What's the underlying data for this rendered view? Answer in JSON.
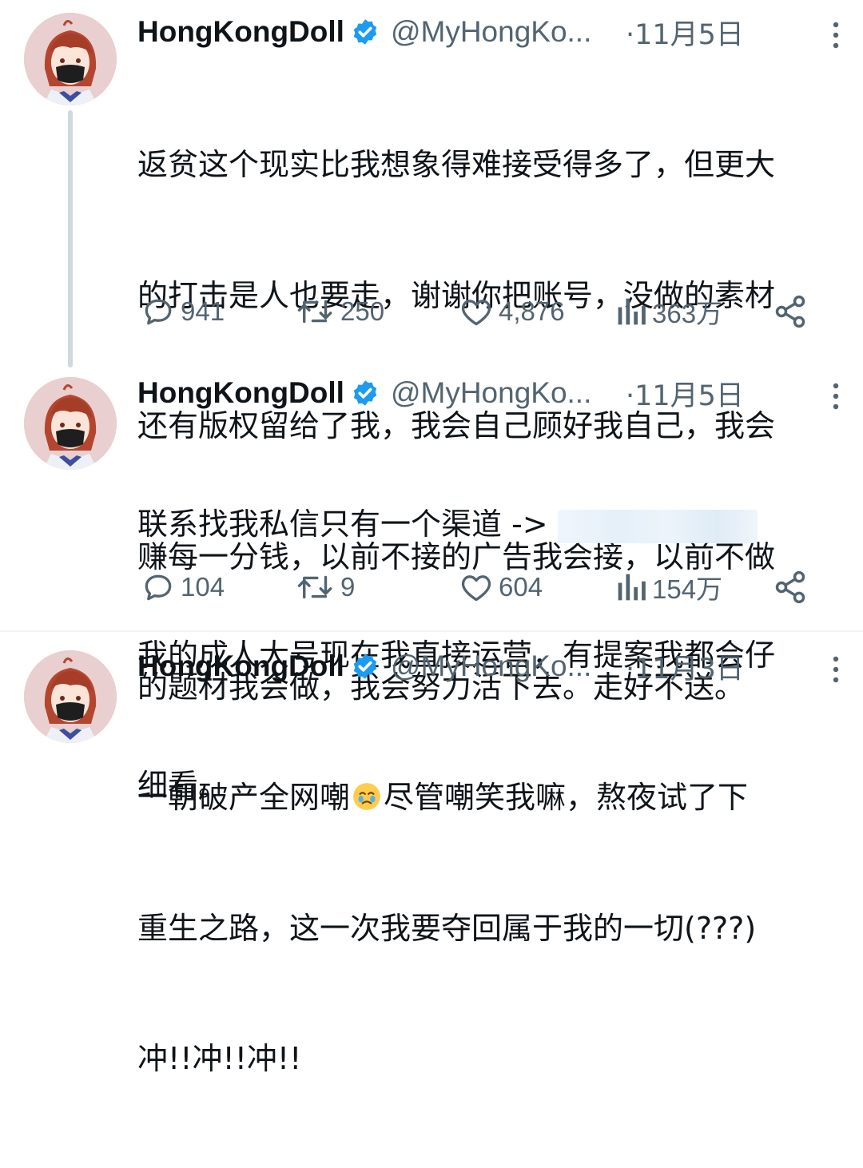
{
  "tweets": [
    {
      "display_name": "HongKongDoll",
      "handle": "@MyHongKo...",
      "date": "·11月5日",
      "lines": [
        "返贫这个现实比我想象得难接受得多了，但更大",
        "的打击是人也要走，谢谢你把账号，没做的素材",
        "还有版权留给了我，我会自己顾好我自己，我会",
        "赚每一分钱，以前不接的广告我会接，以前不做",
        "的题材我会做，我会努力活下去。走好不送。"
      ],
      "replies": "941",
      "retweets": "250",
      "likes": "4,876",
      "views": "363万"
    },
    {
      "display_name": "HongKongDoll",
      "handle": "@MyHongKo...",
      "date": "·11月5日",
      "line1": "联系找我私信只有一个渠道 ->",
      "lines": [
        "我的成人大号现在我直接运营，有提案我都会仔",
        "细看。"
      ],
      "replies": "104",
      "retweets": "9",
      "likes": "604",
      "views": "154万"
    },
    {
      "display_name": "HongKongDoll",
      "handle": "@MyHongKo...",
      "date": "·11月3日",
      "line1_a": "一朝破产全网嘲",
      "line1_b": "尽管嘲笑我嘛，熬夜试了下",
      "lines": [
        "重生之路，这一次我要夺回属于我的一切(???)",
        "冲!!冲!!冲!!"
      ]
    }
  ],
  "colors": {
    "text_primary": "#0f1419",
    "text_secondary": "#536471",
    "verified_blue": "#1d9bf0",
    "thread_line": "#cfd9de",
    "divider": "#eff3f4"
  },
  "icons": {
    "reply": "reply-icon",
    "retweet": "retweet-icon",
    "like": "heart-icon",
    "views": "views-icon",
    "share": "share-icon",
    "verified": "verified-badge-icon",
    "more": "more-icon",
    "emoji": "face-holding-back-tears-emoji"
  }
}
